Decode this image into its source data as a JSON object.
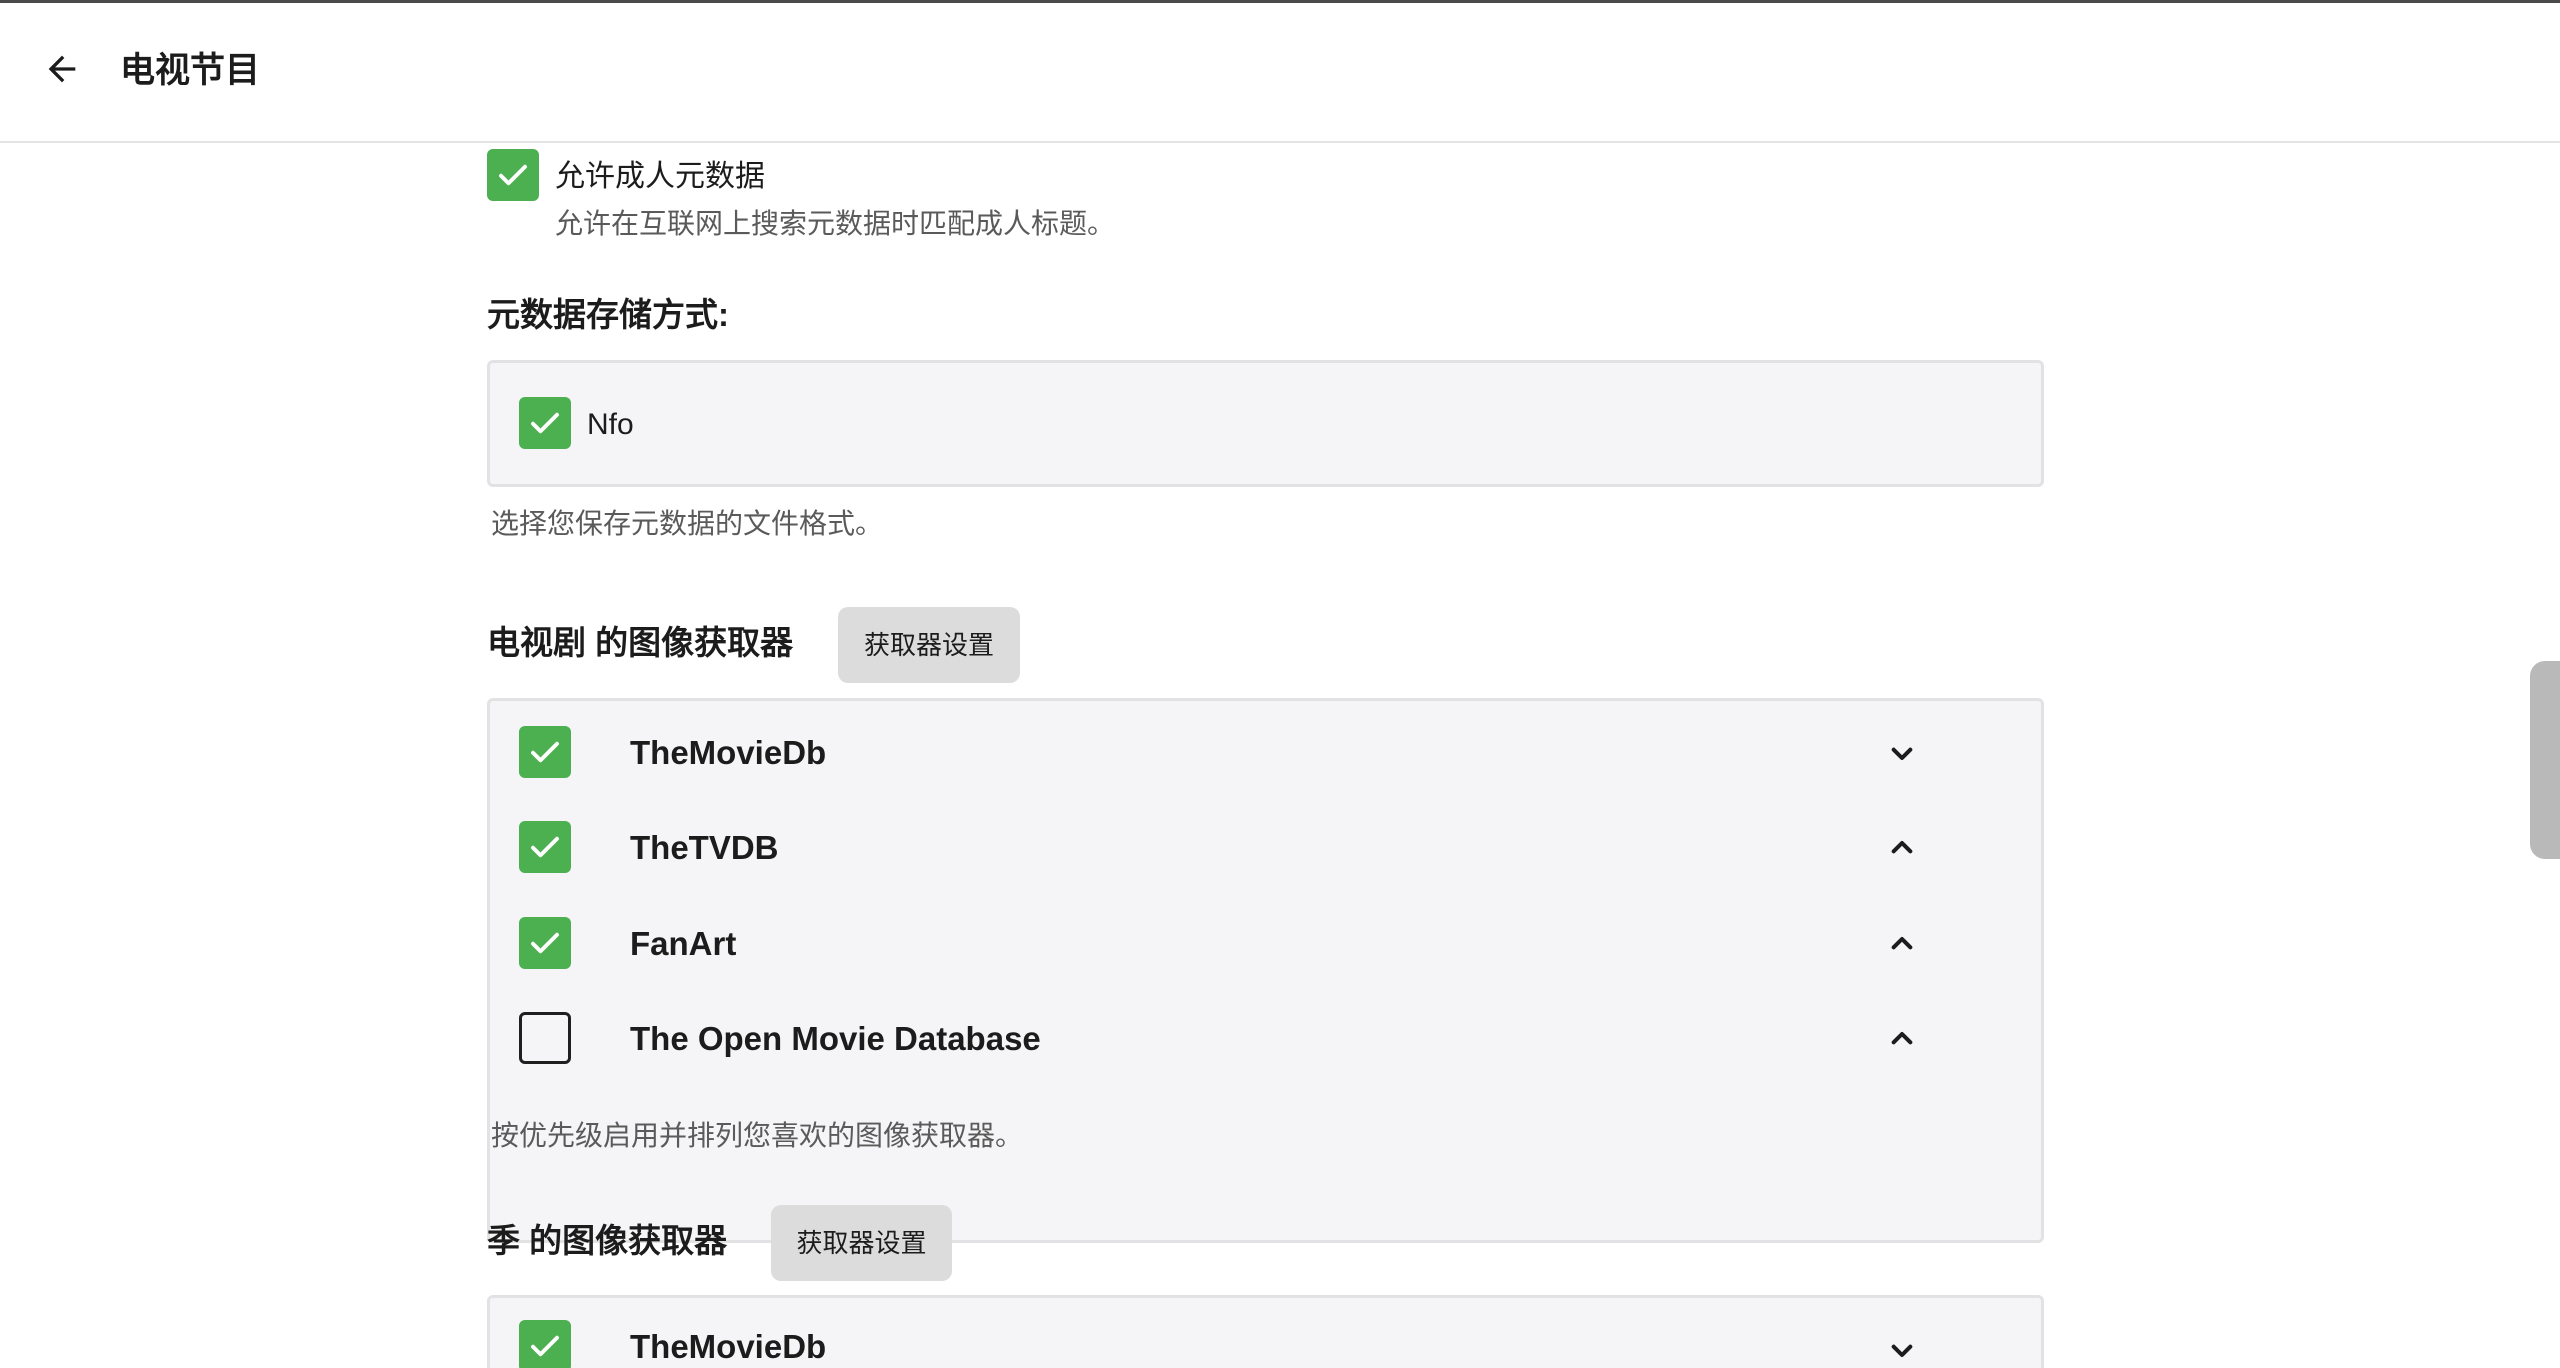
{
  "header": {
    "title": "电视节目",
    "back_icon": "arrow-left-icon"
  },
  "adult_metadata": {
    "label": "允许成人元数据",
    "description": "允许在互联网上搜索元数据时匹配成人标题。",
    "checked": true
  },
  "metadata_savers": {
    "title": "元数据存储方式:",
    "items": [
      {
        "label": "Nfo",
        "checked": true
      }
    ],
    "description": "选择您保存元数据的文件格式。"
  },
  "series_image_fetchers": {
    "title": "电视剧 的图像获取器",
    "settings_button": "获取器设置",
    "items": [
      {
        "name": "TheMovieDb",
        "checked": true,
        "chevron": "chevron-down-icon"
      },
      {
        "name": "TheTVDB",
        "checked": true,
        "chevron": "chevron-up-icon"
      },
      {
        "name": "FanArt",
        "checked": true,
        "chevron": "chevron-up-icon"
      },
      {
        "name": "The Open Movie Database",
        "checked": false,
        "chevron": "chevron-up-icon"
      }
    ],
    "description": "按优先级启用并排列您喜欢的图像获取器。"
  },
  "season_image_fetchers": {
    "title": "季 的图像获取器",
    "settings_button": "获取器设置",
    "items": [
      {
        "name": "TheMovieDb",
        "checked": true,
        "chevron": "chevron-down-icon"
      }
    ]
  },
  "colors": {
    "accent_green": "#4caf50",
    "box_background": "#f5f5f7",
    "button_background": "#dcdcdc"
  }
}
